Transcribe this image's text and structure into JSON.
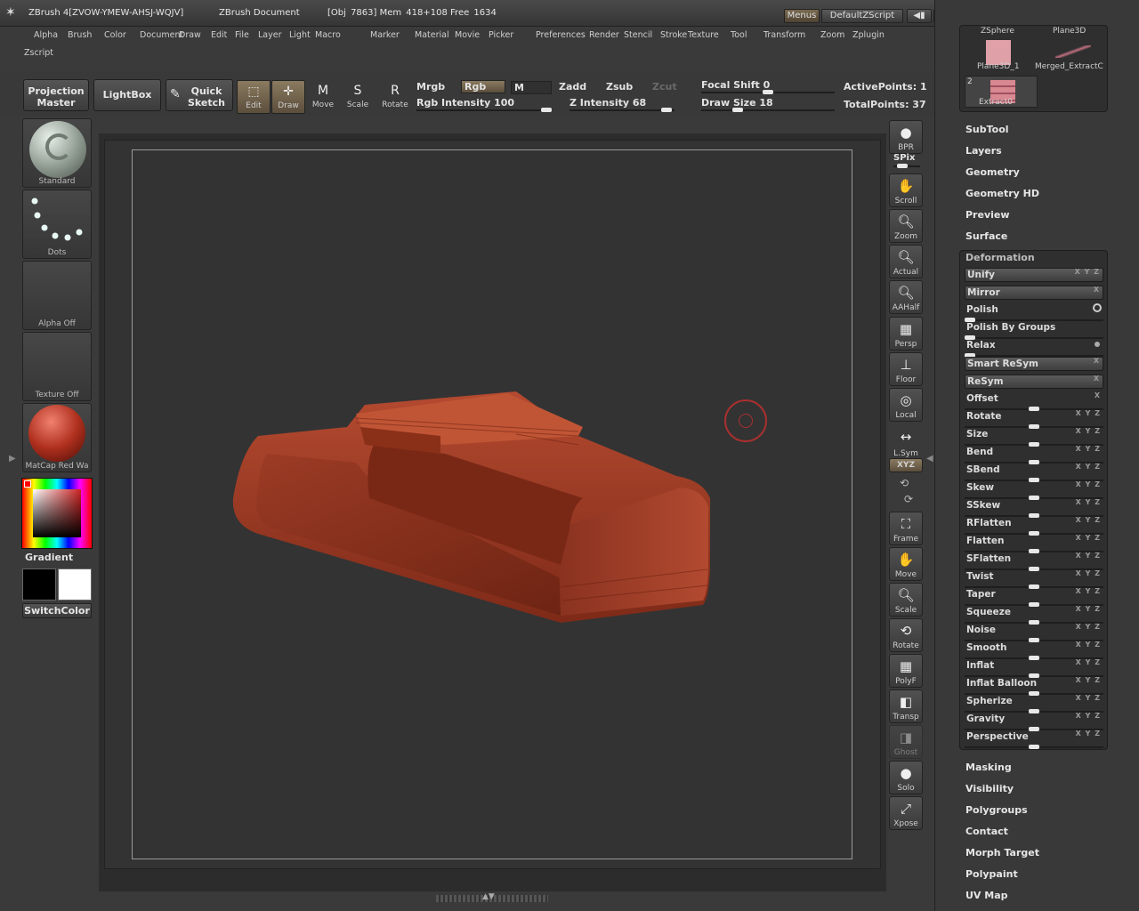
{
  "titlebar": {
    "app_title": "ZBrush 4[ZVOW-YMEW-AHSJ-WQJV]",
    "document": "ZBrush Document",
    "obj_info": "[Obj  7863] Mem  418+108 Free  1634",
    "menus_btn": "Menus",
    "script_btn": "DefaultZScript"
  },
  "menu": {
    "row1": [
      "Alpha",
      "Brush",
      "Color",
      "Document",
      "Draw",
      "Edit",
      "File",
      "Layer",
      "Light",
      "Macro",
      "Marker",
      "Material",
      "Movie",
      "Picker",
      "Preferences",
      "Render",
      "Stencil",
      "Stroke",
      "Texture",
      "Tool",
      "Transform",
      "Zoom",
      "Zplugin"
    ],
    "row2": [
      "Zscript"
    ]
  },
  "toolbar": {
    "projection_master_1": "Projection",
    "projection_master_2": "Master",
    "lightbox": "LightBox",
    "quick_sketch_1": "Quick",
    "quick_sketch_2": "Sketch",
    "tools": [
      {
        "label": "Edit",
        "glyph": "⬚"
      },
      {
        "label": "Draw",
        "glyph": "✛"
      },
      {
        "label": "Move",
        "glyph": "M"
      },
      {
        "label": "Scale",
        "glyph": "S"
      },
      {
        "label": "Rotate",
        "glyph": "R"
      }
    ],
    "mrgb": "Mrgb",
    "rgb": "Rgb",
    "m": "M",
    "zadd": "Zadd",
    "zsub": "Zsub",
    "zcut": "Zcut",
    "rgb_intensity": "Rgb Intensity 100",
    "z_intensity": "Z Intensity 68",
    "focal_shift": "Focal Shift 0",
    "draw_size": "Draw Size 18",
    "active_points": "ActivePoints: 1",
    "total_points": "TotalPoints: 37"
  },
  "shelf": {
    "brush": "Standard",
    "stroke": "Dots",
    "alpha": "Alpha Off",
    "texture": "Texture Off",
    "material": "MatCap Red Wa",
    "gradient": "Gradient",
    "switch_color": "SwitchColor"
  },
  "rtools": [
    "BPR",
    "SPix",
    "Scroll",
    "Zoom",
    "Actual",
    "AAHalf",
    "Persp",
    "Floor",
    "Local",
    "L.Sym",
    "XYZ",
    "Frame",
    "Move",
    "Scale",
    "Rotate",
    "PolyF",
    "Transp",
    "Ghost",
    "Solo",
    "Xpose"
  ],
  "subtool_thumbs": [
    "ZSphere",
    "Plane3D",
    "Plane3D_1",
    "Merged_ExtractC",
    "Extract0"
  ],
  "thumb_count": "2",
  "panel_heads_top": [
    "SubTool",
    "Layers",
    "Geometry",
    "Geometry HD",
    "Preview",
    "Surface"
  ],
  "deformation": {
    "title": "Deformation",
    "rows": [
      {
        "name": "Unify",
        "axes": "X Y Z",
        "type": "button"
      },
      {
        "name": "Mirror",
        "axes": "X",
        "type": "button"
      },
      {
        "name": "Polish",
        "axes": "",
        "type": "slider",
        "value": 0
      },
      {
        "name": "Polish By Groups",
        "axes": "",
        "type": "slider",
        "value": 0
      },
      {
        "name": "Relax",
        "axes": "",
        "type": "slider",
        "value": 0
      },
      {
        "name": "Smart ReSym",
        "axes": "X",
        "type": "button"
      },
      {
        "name": "ReSym",
        "axes": "X",
        "type": "button"
      },
      {
        "name": "Offset",
        "axes": "X",
        "type": "slider",
        "value": 50
      },
      {
        "name": "Rotate",
        "axes": "X Y Z",
        "type": "slider",
        "value": 50
      },
      {
        "name": "Size",
        "axes": "X Y Z",
        "type": "slider",
        "value": 50
      },
      {
        "name": "Bend",
        "axes": "X Y Z",
        "type": "slider",
        "value": 50
      },
      {
        "name": "SBend",
        "axes": "X Y Z",
        "type": "slider",
        "value": 50
      },
      {
        "name": "Skew",
        "axes": "X Y Z",
        "type": "slider",
        "value": 50
      },
      {
        "name": "SSkew",
        "axes": "X Y Z",
        "type": "slider",
        "value": 50
      },
      {
        "name": "RFlatten",
        "axes": "X Y Z",
        "type": "slider",
        "value": 50
      },
      {
        "name": "Flatten",
        "axes": "X Y Z",
        "type": "slider",
        "value": 50
      },
      {
        "name": "SFlatten",
        "axes": "X Y Z",
        "type": "slider",
        "value": 50
      },
      {
        "name": "Twist",
        "axes": "X Y Z",
        "type": "slider",
        "value": 50
      },
      {
        "name": "Taper",
        "axes": "X Y Z",
        "type": "slider",
        "value": 50
      },
      {
        "name": "Squeeze",
        "axes": "X Y Z",
        "type": "slider",
        "value": 50
      },
      {
        "name": "Noise",
        "axes": "X Y Z",
        "type": "slider",
        "value": 50
      },
      {
        "name": "Smooth",
        "axes": "X Y Z",
        "type": "slider",
        "value": 50
      },
      {
        "name": "Inflat",
        "axes": "X Y Z",
        "type": "slider",
        "value": 50
      },
      {
        "name": "Inflat Balloon",
        "axes": "X Y Z",
        "type": "slider",
        "value": 50
      },
      {
        "name": "Spherize",
        "axes": "X Y Z",
        "type": "slider",
        "value": 50
      },
      {
        "name": "Gravity",
        "axes": "X Y Z",
        "type": "slider",
        "value": 50
      },
      {
        "name": "Perspective",
        "axes": "X Y Z",
        "type": "slider",
        "value": 50
      }
    ]
  },
  "panel_heads_bottom": [
    "Masking",
    "Visibility",
    "Polygroups",
    "Contact",
    "Morph Target",
    "Polypaint",
    "UV Map"
  ],
  "colors": {
    "accent": "#8a7a60",
    "mesh": "#a8402a",
    "brush_circle": "#b33"
  }
}
